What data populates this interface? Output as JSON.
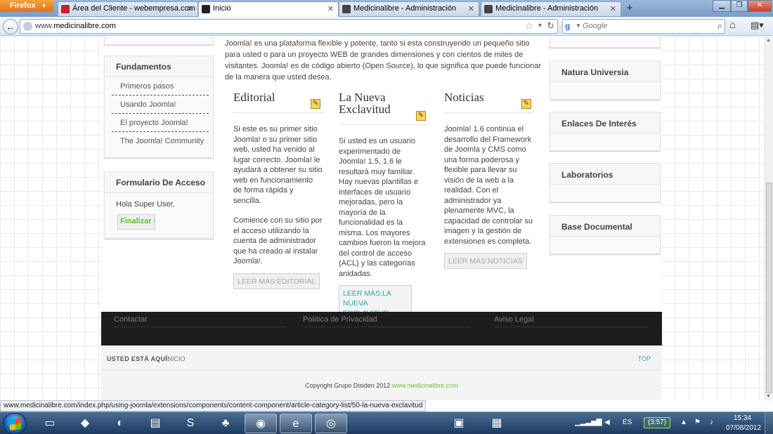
{
  "browser": {
    "app_button": "Firefox",
    "tabs": [
      {
        "label": "Área del Cliente - webempresa.com",
        "color": "#c8202a"
      },
      {
        "label": "Inicio",
        "color": "#222222"
      },
      {
        "label": "Medicinalibre - Administración",
        "color": "#444444"
      },
      {
        "label": "Medicinalibre - Administración",
        "color": "#444444"
      }
    ],
    "url_host": "www.",
    "url_domain": "medicinalibre.com",
    "search_placeholder": "Google",
    "status_url": "www.medicinalibre.com/index.php/using-joomla/extensions/components/content-component/article-category-list/50-la-nueva-exclavitud"
  },
  "left_sidebar": {
    "fundamentos": {
      "title": "Fundamentos",
      "items": [
        "Primeros pasos",
        "Usando Joomla!",
        "El proyecto Joomla!",
        "The Joomla! Community"
      ]
    },
    "login": {
      "title": "Formulario De Acceso",
      "greeting": "Hola Super User,",
      "button": "Finalizar sesión"
    }
  },
  "main": {
    "intro": "Joomla! es una plataforma flexible y potente, tanto si esta construyendo un pequeño sitio para usted o para un proyecto WEB de grandes dimensiones y con cientos de miles de visitantes. Joomla! es de código abierto (Open Source), lo que significa que puede funcionar de la manera que usted desea.",
    "columns": [
      {
        "title": "Editorial",
        "paragraphs": [
          "Si este es su primer sitio Joomla! o su primer sitio web, usted ha venido al lugar correcto. Joomla! le ayudará a obtener su sitio web en funcionamiento de forma rápida y sencilla.",
          "Comience con su sitio por el acceso utilizando la cuenta de administrador que ha creado al instalar Joomla!."
        ],
        "readmore": "LEER MÁS:EDITORIAL"
      },
      {
        "title": "La Nueva Exclavitud",
        "paragraphs": [
          "Si usted es un usuario experimentado de Joomla! 1.5, 1.6 le resultará muy familiar. Hay nuevas plantillas e interfaces de usuario mejoradas, pero la mayoría de la funcionalidad es la misma. Los mayores cambios fueron la mejora del control de acceso (ACL) y las categorías anidadas."
        ],
        "readmore": "LEER MÁS:LA NUEVA EXCLAVITUD"
      },
      {
        "title": "Noticias",
        "paragraphs": [
          "Joomla! 1.6 continúa el desarrollo del Framework de Joomla y CMS como una forma poderosa y flexible para llevar su visión de la web a la realidad. Con el administrador ya plenamente MVC, la capacidad de controlar su imagen y la gestión de extensiones es completa."
        ],
        "readmore": "LEER MÁS:NOTICIAS"
      }
    ]
  },
  "right_sidebar": {
    "modules": [
      "Natura Universia",
      "Enlaces De Interés",
      "Laboratorios",
      "Base Documental"
    ]
  },
  "footer": {
    "links": [
      "Contactar",
      "Política de Privacidad",
      "Aviso Legal"
    ],
    "breadcrumb_label": "USTED ESTÁ AQUÍ:",
    "breadcrumb_current": "INICIO",
    "top_link": "TOP",
    "copyright": "Copyright Grupo Disiden 2012",
    "copyright_link": "www.medicinalibre.com"
  },
  "taskbar": {
    "language": "ES",
    "battery": "(3:57)",
    "time": "15:34",
    "date": "07/08/2012"
  }
}
